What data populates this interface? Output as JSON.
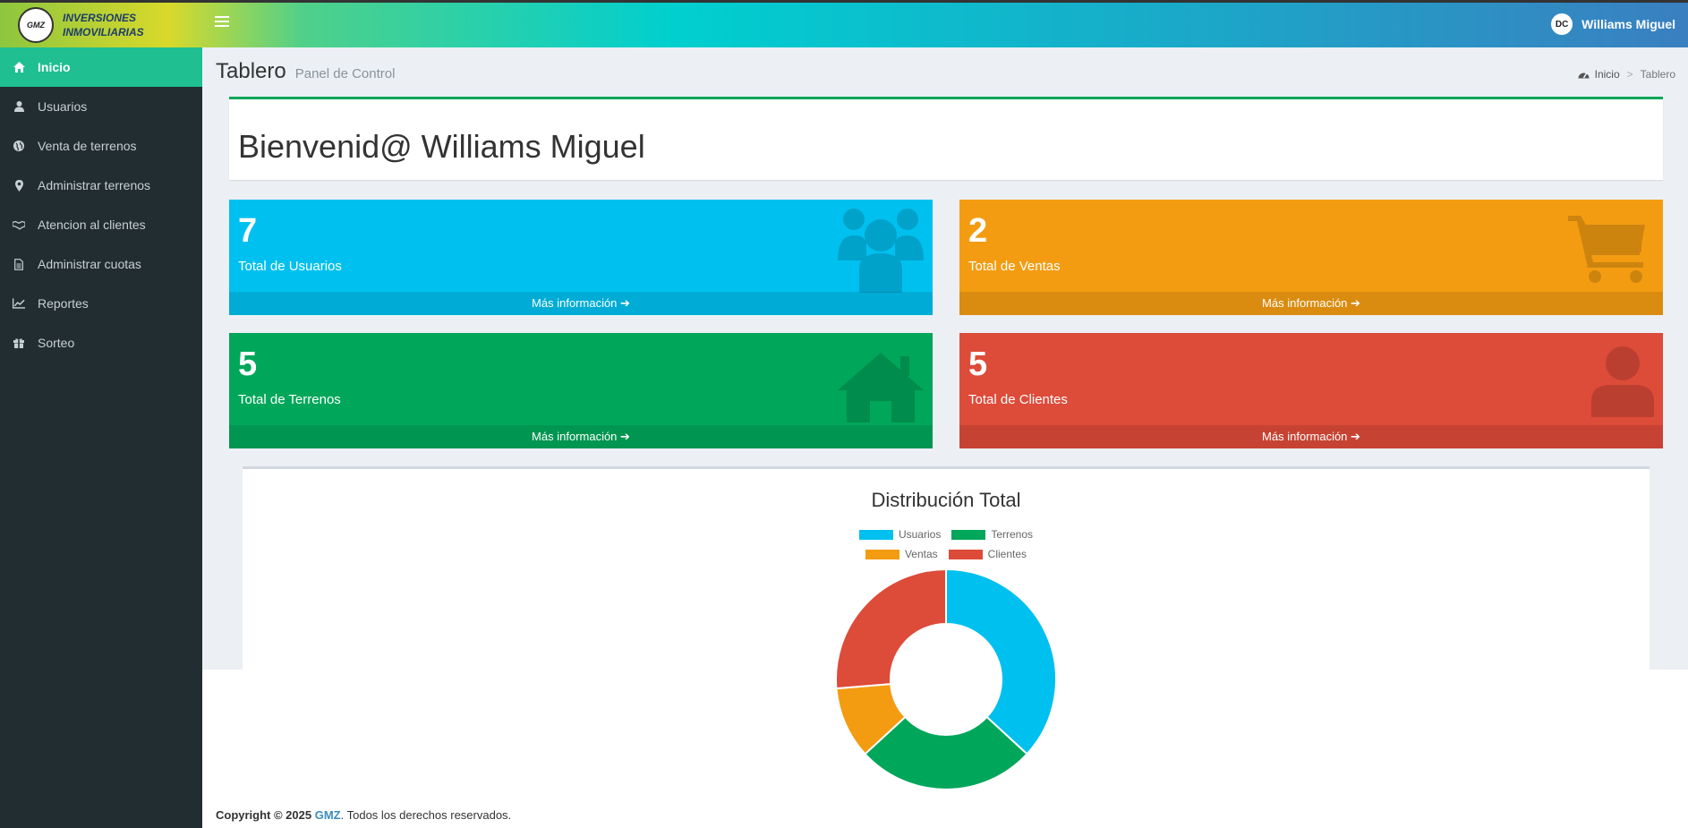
{
  "brand": {
    "logo_text": "GMZ",
    "name_line1": "INVERSIONES",
    "name_line2": "INMOVILIARIAS"
  },
  "header": {
    "user_name": "Williams Miguel",
    "avatar_text": "DC"
  },
  "sidebar": {
    "items": [
      {
        "label": "Inicio",
        "icon": "home-icon"
      },
      {
        "label": "Usuarios",
        "icon": "user-icon"
      },
      {
        "label": "Venta de terrenos",
        "icon": "globe-icon"
      },
      {
        "label": "Administrar terrenos",
        "icon": "map-marker-icon"
      },
      {
        "label": "Atencion al clientes",
        "icon": "handshake-icon"
      },
      {
        "label": "Administrar cuotas",
        "icon": "document-icon"
      },
      {
        "label": "Reportes",
        "icon": "line-chart-icon"
      },
      {
        "label": "Sorteo",
        "icon": "gift-icon"
      }
    ]
  },
  "content_header": {
    "title": "Tablero",
    "subtitle": "Panel de Control"
  },
  "breadcrumb": {
    "home": "Inicio",
    "separator": ">",
    "current": "Tablero"
  },
  "welcome": {
    "text": "Bienvenid@ Williams Miguel"
  },
  "stats": [
    {
      "value": "7",
      "label": "Total de Usuarios",
      "more": "Más información",
      "color": "#00c0ef",
      "icon": "users-icon"
    },
    {
      "value": "2",
      "label": "Total de Ventas",
      "more": "Más información",
      "color": "#f39c12",
      "icon": "cart-icon"
    },
    {
      "value": "5",
      "label": "Total de Terrenos",
      "more": "Más información",
      "color": "#00a65a",
      "icon": "house-icon"
    },
    {
      "value": "5",
      "label": "Total de Clientes",
      "more": "Más información",
      "color": "#dd4b39",
      "icon": "person-icon"
    }
  ],
  "chart_data": {
    "type": "pie",
    "title": "Distribución Total",
    "categories": [
      "Usuarios",
      "Terrenos",
      "Ventas",
      "Clientes"
    ],
    "values": [
      7,
      5,
      2,
      5
    ],
    "colors": [
      "#00c0ef",
      "#00a65a",
      "#f39c12",
      "#dd4b39"
    ],
    "legend_position": "top"
  },
  "footer": {
    "prefix": "Copyright © 2025",
    "brand": "GMZ",
    "suffix": ". Todos los derechos reservados."
  }
}
